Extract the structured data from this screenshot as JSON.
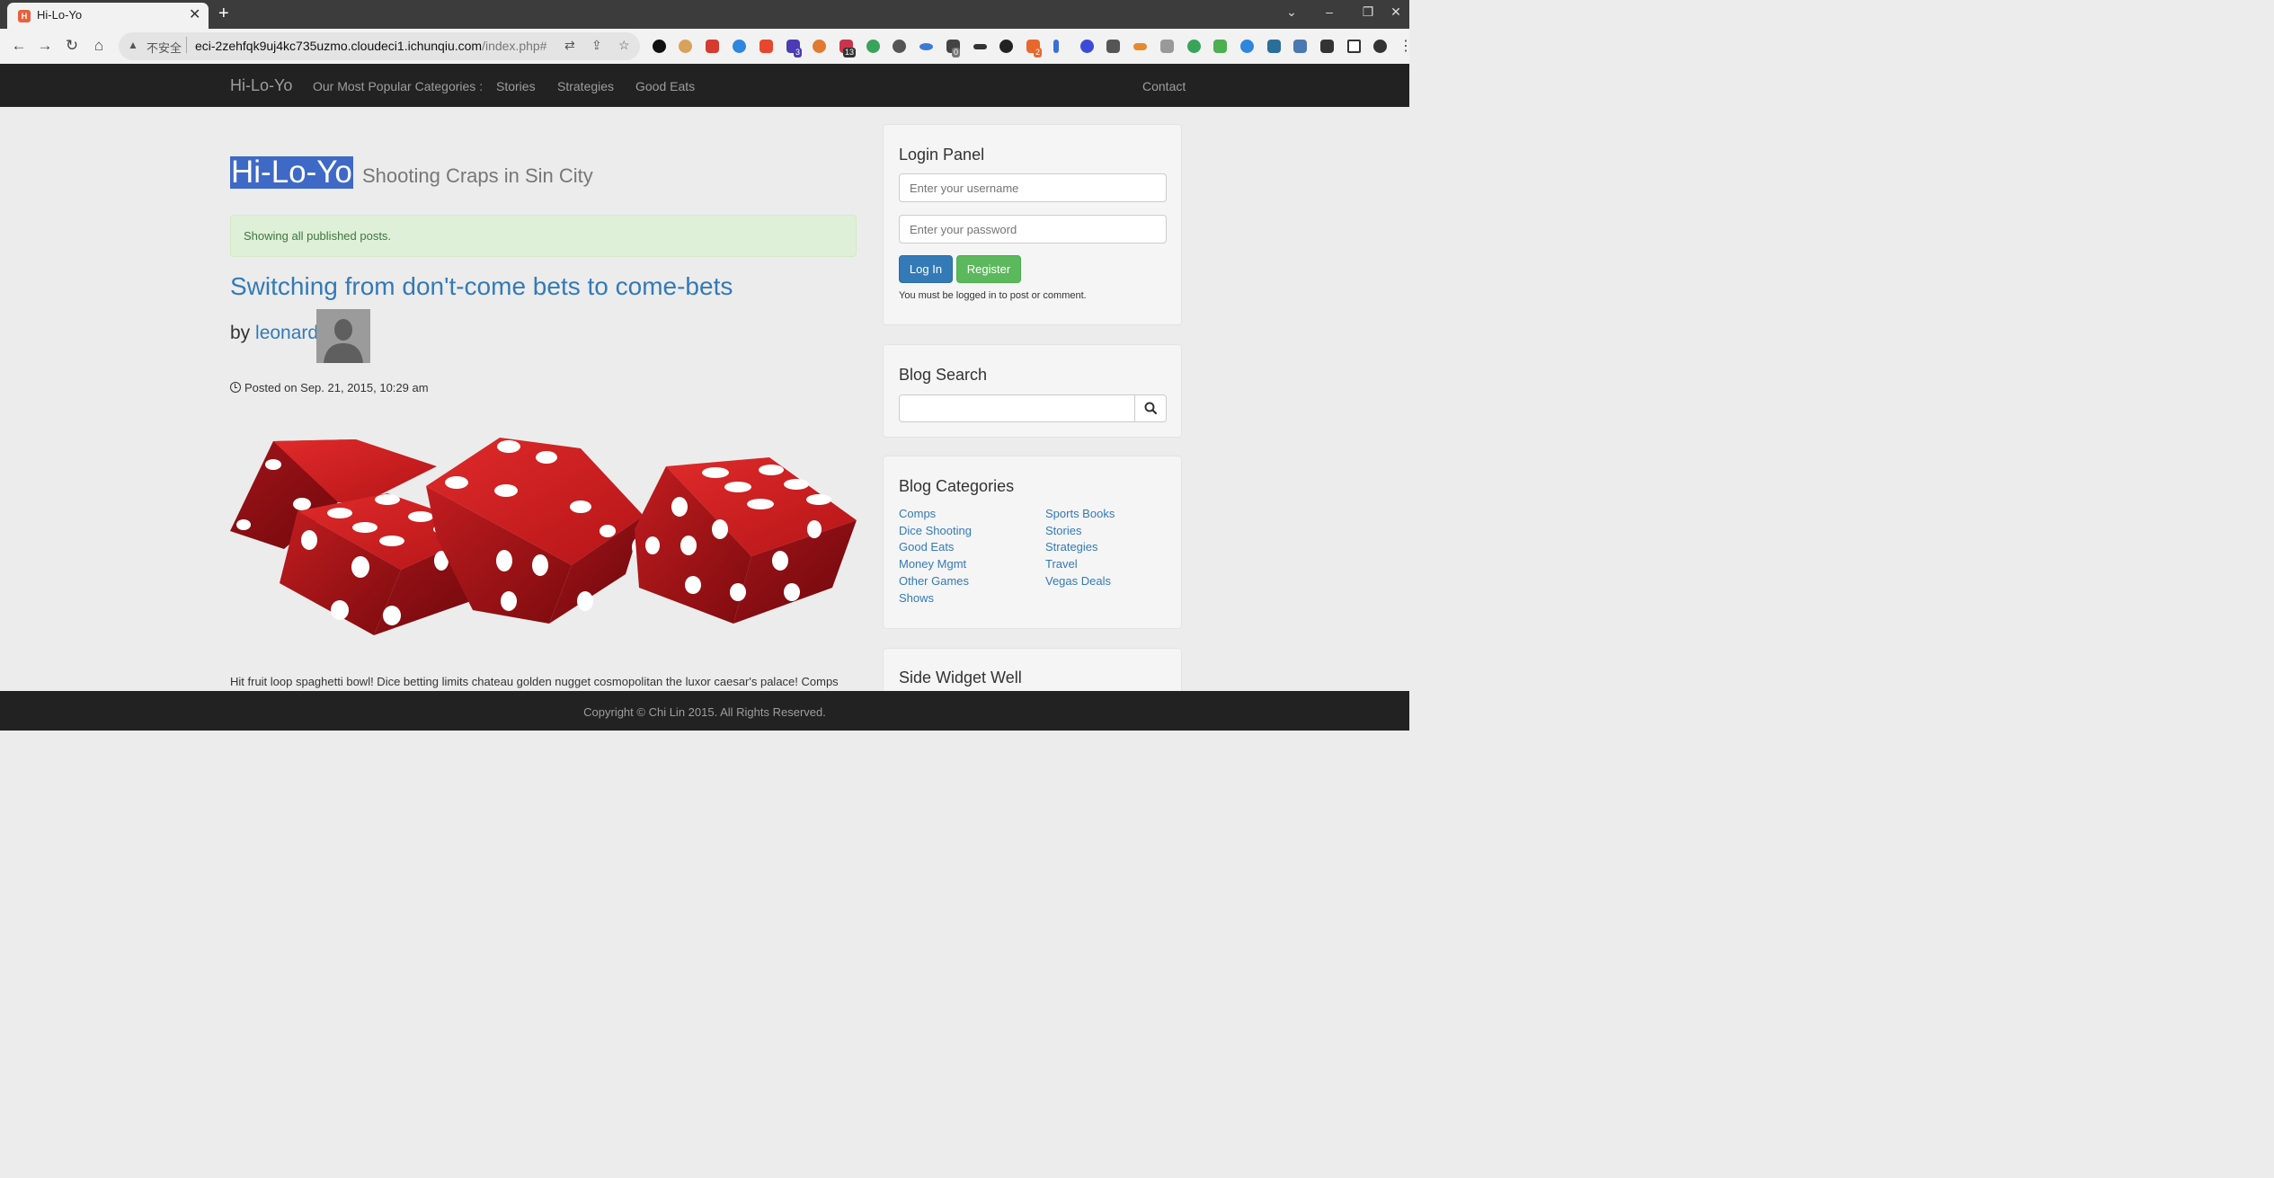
{
  "browser": {
    "tab_title": "Hi-Lo-Yo",
    "tab_close": "✕",
    "new_tab": "+",
    "insecure_label": "不安全",
    "url_host": "eci-2zehfqk9uj4kc735uzmo.cloudeci1.ichunqiu.com",
    "url_path": "/index.php#",
    "ext_badges": [
      "3",
      "13",
      "0",
      "2"
    ]
  },
  "navbar": {
    "brand": "Hi-Lo-Yo",
    "links": [
      "Our Most Popular Categories :",
      "Stories",
      "Strategies",
      "Good Eats"
    ],
    "contact": "Contact"
  },
  "main": {
    "site_title": "Hi-Lo-Yo",
    "tagline": "Shooting Craps in Sin City",
    "alert": "Showing all published posts.",
    "post": {
      "title": "Switching from don't-come bets to come-bets",
      "by": "by",
      "author": "leonard",
      "posted": "Posted on Sep. 21, 2015, 10:29 am",
      "excerpt": "Hit fruit loop spaghetti bowl! Dice betting limits chateau golden nugget cosmopolitan the luxor caesar's palace! Comps"
    }
  },
  "sidebar": {
    "login": {
      "title": "Login Panel",
      "username_placeholder": "Enter your username",
      "password_placeholder": "Enter your password",
      "login_button": "Log In",
      "register_button": "Register",
      "note": "You must be logged in to post or comment."
    },
    "search": {
      "title": "Blog Search"
    },
    "categories": {
      "title": "Blog Categories",
      "left": [
        "Comps",
        "Dice Shooting",
        "Good Eats",
        "Money Mgmt",
        "Other Games",
        "Shows"
      ],
      "right": [
        "Sports Books",
        "Stories",
        "Strategies",
        "Travel",
        "Vegas Deals"
      ]
    },
    "widget": {
      "title": "Side Widget Well"
    }
  },
  "footer": {
    "text": "Copyright © Chi Lin 2015. All Rights Reserved."
  },
  "colors": {
    "link": "#337ab7",
    "navbar": "#222222",
    "alert_bg": "#dff0d8",
    "dice": "#c8181c",
    "selection": "#3e69c6"
  }
}
